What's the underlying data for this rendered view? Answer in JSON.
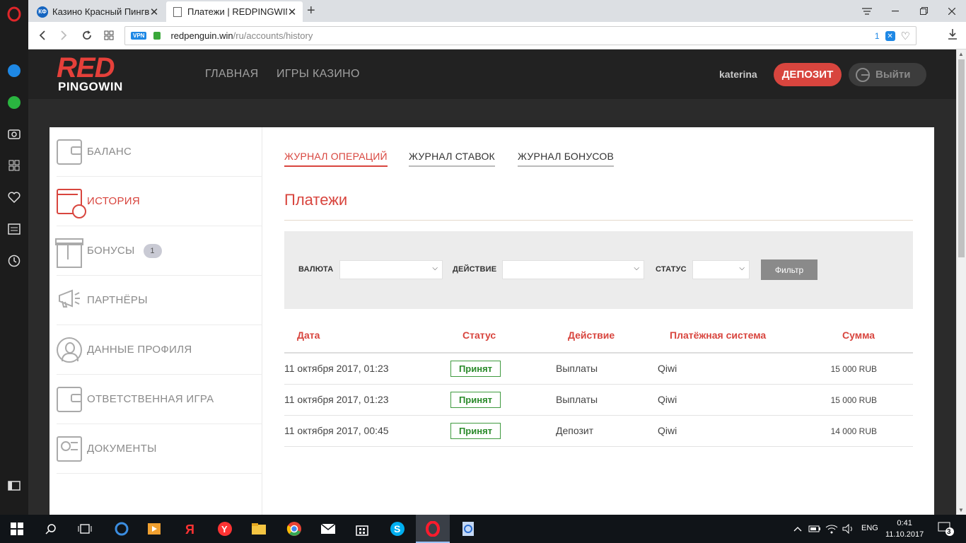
{
  "browser": {
    "tabs": [
      {
        "favicon": "КФ",
        "title": "Казино Красный Пингвин",
        "close": "✕"
      },
      {
        "title": "Платежи | REDPINGWIN",
        "close": "✕"
      }
    ],
    "new_tab": "+",
    "address": {
      "vpn": "VPN",
      "url_host": "redpenguin.win",
      "url_path": "/ru/accounts/history",
      "adblock_count": "1"
    }
  },
  "site": {
    "logo_top": "RED",
    "logo_bottom": "PINGOWIN",
    "nav": {
      "home": "ГЛАВНАЯ",
      "games": "ИГРЫ КАЗИНО"
    },
    "username": "katerina",
    "deposit": "ДЕПОЗИТ",
    "logout": "Выйти"
  },
  "account_menu": [
    {
      "label": "БАЛАНС",
      "icon": "wallet-icon"
    },
    {
      "label": "ИСТОРИЯ",
      "icon": "calendar-clock-icon",
      "active": true
    },
    {
      "label": "БОНУСЫ",
      "icon": "gift-icon",
      "badge": "1"
    },
    {
      "label": "ПАРТНЁРЫ",
      "icon": "megaphone-icon"
    },
    {
      "label": "ДАННЫЕ ПРОФИЛЯ",
      "icon": "user-icon"
    },
    {
      "label": "ОТВЕТСТВЕННАЯ ИГРА",
      "icon": "wallet-icon"
    },
    {
      "label": "ДОКУМЕНТЫ",
      "icon": "id-card-icon"
    }
  ],
  "subtabs": {
    "operations": "ЖУРНАЛ ОПЕРАЦИЙ",
    "bets": "ЖУРНАЛ СТАВОК",
    "bonuses": "ЖУРНАЛ БОНУСОВ"
  },
  "page_title": "Платежи",
  "filter": {
    "currency_label": "ВАЛЮТА",
    "action_label": "ДЕЙСТВИЕ",
    "status_label": "СТАТУС",
    "button": "Фильтр"
  },
  "table": {
    "headers": [
      "Дата",
      "Статус",
      "Действие",
      "Платёжная система",
      "Сумма"
    ],
    "rows": [
      {
        "date": "11 октября 2017, 01:23",
        "status": "Принят",
        "action": "Выплаты",
        "system": "Qiwi",
        "amount": "15 000 RUB"
      },
      {
        "date": "11 октября 2017, 01:23",
        "status": "Принят",
        "action": "Выплаты",
        "system": "Qiwi",
        "amount": "15 000 RUB"
      },
      {
        "date": "11 октября 2017, 00:45",
        "status": "Принят",
        "action": "Депозит",
        "system": "Qiwi",
        "amount": "14 000 RUB"
      }
    ]
  },
  "taskbar": {
    "lang": "ENG",
    "time": "0:41",
    "date": "11.10.2017",
    "notifications": "3"
  },
  "colors": {
    "accent": "#d8453e",
    "success": "#2a8a2a",
    "header_bg": "#222222"
  }
}
